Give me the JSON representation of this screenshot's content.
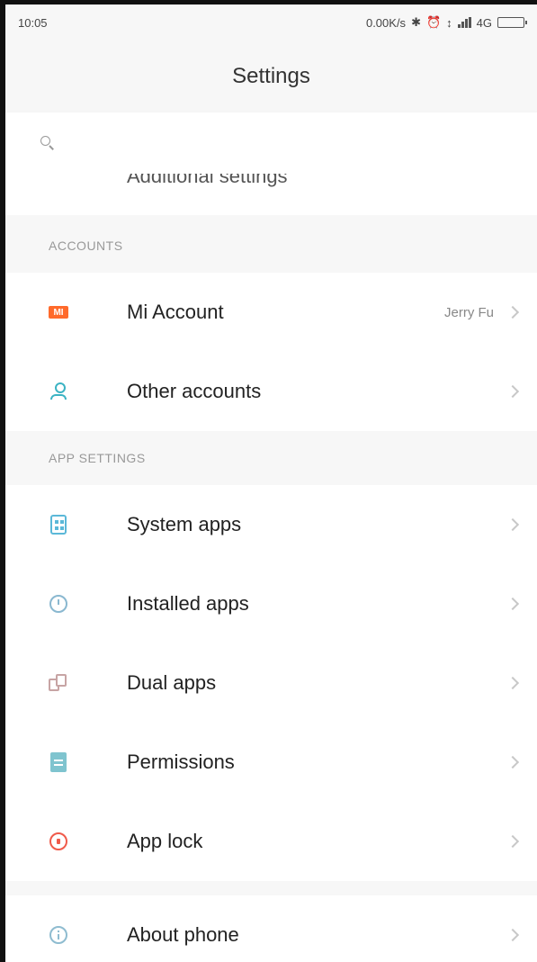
{
  "status_bar": {
    "time": "10:05",
    "network_speed": "0.00K/s",
    "network_type": "4G"
  },
  "header": {
    "title": "Settings"
  },
  "search": {
    "placeholder": ""
  },
  "cut_item": {
    "label": "Additional settings"
  },
  "sections": {
    "accounts": {
      "header": "ACCOUNTS",
      "items": [
        {
          "label": "Mi Account",
          "value": "Jerry Fu",
          "icon": "mi-icon"
        },
        {
          "label": "Other accounts",
          "icon": "person-icon"
        }
      ]
    },
    "app_settings": {
      "header": "APP SETTINGS",
      "items": [
        {
          "label": "System apps",
          "icon": "grid-icon"
        },
        {
          "label": "Installed apps",
          "icon": "clock-icon"
        },
        {
          "label": "Dual apps",
          "icon": "dual-icon"
        },
        {
          "label": "Permissions",
          "icon": "permission-icon"
        },
        {
          "label": "App lock",
          "icon": "lock-icon"
        }
      ]
    },
    "about": {
      "items": [
        {
          "label": "About phone",
          "icon": "info-icon"
        }
      ]
    }
  },
  "colors": {
    "mi_orange": "#ff6a2b",
    "lock_red": "#f05a4a",
    "accent_teal": "#3bb3c3"
  }
}
